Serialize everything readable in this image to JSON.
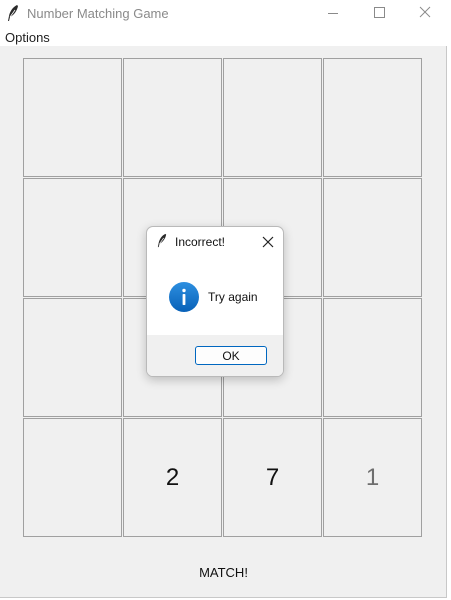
{
  "window": {
    "title": "Number Matching Game",
    "icon": "feather-icon",
    "controls": [
      "minimize-icon",
      "maximize-icon",
      "close-icon"
    ]
  },
  "menubar": {
    "items": [
      {
        "label": "Options"
      }
    ]
  },
  "grid": {
    "rows": 4,
    "columns": 4,
    "cells": [
      {
        "value": ""
      },
      {
        "value": ""
      },
      {
        "value": ""
      },
      {
        "value": ""
      },
      {
        "value": ""
      },
      {
        "value": ""
      },
      {
        "value": ""
      },
      {
        "value": ""
      },
      {
        "value": ""
      },
      {
        "value": ""
      },
      {
        "value": ""
      },
      {
        "value": ""
      },
      {
        "value": ""
      },
      {
        "value": "2"
      },
      {
        "value": "7"
      },
      {
        "value": "1"
      }
    ]
  },
  "status": {
    "label": "MATCH!"
  },
  "dialog": {
    "title": "Incorrect!",
    "message": "Try again",
    "icon": "info-icon",
    "ok_label": "OK"
  },
  "colors": {
    "window_bg": "#f0f0f0",
    "cell_border": "#a0a0a0",
    "info_blue": "#0a74d0",
    "button_accent": "#0067c0",
    "dim_number": "#6e6e6e"
  }
}
